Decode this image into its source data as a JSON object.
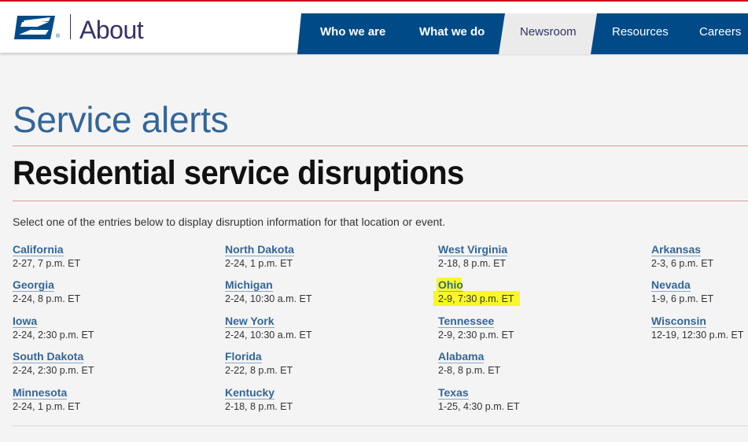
{
  "colors": {
    "brand_blue": "#004b87",
    "accent_red": "#c8141f",
    "title_blue": "#336699",
    "highlight": "#f7f72a"
  },
  "header": {
    "logo_icon": "eagle-icon",
    "title": "About",
    "nav": [
      {
        "label": "Who we are",
        "active": false
      },
      {
        "label": "What we do",
        "active": false
      },
      {
        "label": "Newsroom",
        "active": true
      },
      {
        "label": "Resources",
        "active": false
      },
      {
        "label": "Careers",
        "active": false
      }
    ]
  },
  "main": {
    "page_title": "Service alerts",
    "section_title": "Residential service disruptions",
    "intro": "Select one of the entries below to display disruption information for that location or event.",
    "entries": [
      {
        "name": "California",
        "date": "2-27, 7 p.m. ET"
      },
      {
        "name": "Georgia",
        "date": "2-24, 8 p.m. ET"
      },
      {
        "name": "Iowa",
        "date": "2-24, 2:30 p.m. ET"
      },
      {
        "name": "South Dakota",
        "date": "2-24, 2:30 p.m. ET"
      },
      {
        "name": "Minnesota",
        "date": "2-24, 1 p.m. ET"
      },
      {
        "name": "North Dakota",
        "date": "2-24, 1 p.m. ET"
      },
      {
        "name": "Michigan",
        "date": "2-24, 10:30 a.m. ET"
      },
      {
        "name": "New York",
        "date": "2-24, 10:30 a.m. ET"
      },
      {
        "name": "Florida",
        "date": "2-22, 8 p.m. ET"
      },
      {
        "name": "Kentucky",
        "date": "2-18, 8 p.m. ET"
      },
      {
        "name": "West Virginia",
        "date": "2-18, 8 p.m. ET"
      },
      {
        "name": "Ohio",
        "date": "2-9, 7:30 p.m. ET",
        "highlighted": true
      },
      {
        "name": "Tennessee",
        "date": "2-9, 2:30 p.m. ET"
      },
      {
        "name": "Alabama",
        "date": "2-8, 8 p.m. ET"
      },
      {
        "name": "Texas",
        "date": "1-25, 4:30 p.m. ET"
      },
      {
        "name": "Arkansas",
        "date": "2-3, 6 p.m. ET"
      },
      {
        "name": "Nevada",
        "date": "1-9, 6 p.m. ET"
      },
      {
        "name": "Wisconsin",
        "date": "12-19, 12:30 p.m. ET"
      }
    ]
  }
}
